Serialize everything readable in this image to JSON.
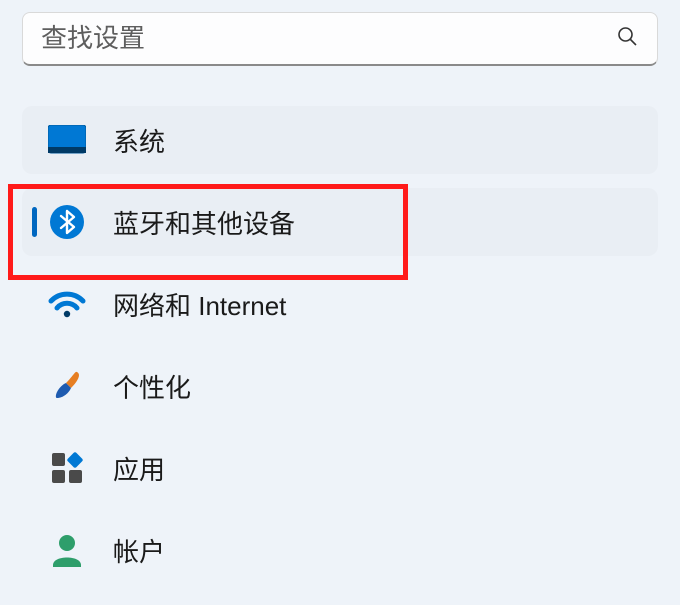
{
  "search": {
    "placeholder": "查找设置"
  },
  "nav": {
    "items": [
      {
        "label": "系统"
      },
      {
        "label": "蓝牙和其他设备"
      },
      {
        "label": "网络和 Internet"
      },
      {
        "label": "个性化"
      },
      {
        "label": "应用"
      },
      {
        "label": "帐户"
      }
    ]
  },
  "colors": {
    "accent": "#0067c0",
    "highlight": "#ff1a1a"
  }
}
